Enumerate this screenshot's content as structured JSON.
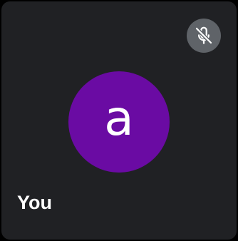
{
  "participant": {
    "name": "You",
    "avatar_initial": "a",
    "avatar_color": "#6a0ba3",
    "mic_status_icon": "mic-off-icon"
  },
  "theme": {
    "tile_background": "#202124",
    "mute_button_background": "#5f6368",
    "icon_color": "#ffffff"
  }
}
